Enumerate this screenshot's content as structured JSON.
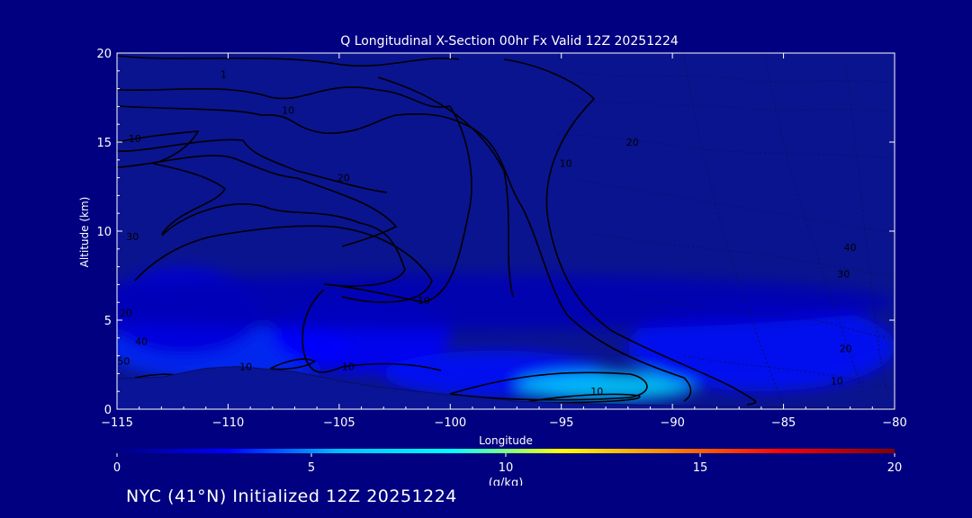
{
  "footer_text": "NYC (41°N) Initialized 12Z 20251224",
  "chart_data": {
    "type": "heatmap",
    "title": "Q Longitudinal X-Section 00hr  Fx Valid 12Z 20251224",
    "xlabel": "Longitude",
    "ylabel": "Altitude (km)",
    "xlim": [
      -115,
      -80
    ],
    "ylim": [
      0,
      20
    ],
    "xticks": [
      -115,
      -110,
      -105,
      -100,
      -95,
      -90,
      -85,
      -80
    ],
    "xtick_labels": [
      "−115",
      "−110",
      "−105",
      "−100",
      "−95",
      "−90",
      "−85",
      "−80"
    ],
    "yticks": [
      0,
      5,
      10,
      15,
      20
    ],
    "colorbar": {
      "label": "(g/kg)",
      "range": [
        0,
        20
      ],
      "ticks": [
        0,
        5,
        10,
        15,
        20
      ],
      "colors": [
        "#000080",
        "#0000ff",
        "#00bfff",
        "#00ffff",
        "#ffff00",
        "#ff8000",
        "#ff0000",
        "#800000"
      ]
    },
    "terrain": [
      {
        "x": -115,
        "y": 1.7
      },
      {
        "x": -113,
        "y": 1.8
      },
      {
        "x": -111,
        "y": 2.3
      },
      {
        "x": -109.5,
        "y": 2.4
      },
      {
        "x": -107,
        "y": 2.1
      },
      {
        "x": -105,
        "y": 1.6
      },
      {
        "x": -103,
        "y": 1.2
      },
      {
        "x": -100,
        "y": 0.8
      },
      {
        "x": -97,
        "y": 0.45
      },
      {
        "x": -95,
        "y": 0.35
      },
      {
        "x": -90,
        "y": 0.2
      },
      {
        "x": -85,
        "y": 0.1
      },
      {
        "x": -80,
        "y": 0.05
      }
    ],
    "moisture_regions": [
      {
        "xc": -110,
        "yc": 3.4,
        "rx": 5.5,
        "ry": 1.8,
        "q": 3.5
      },
      {
        "xc": -104,
        "yc": 4.2,
        "rx": 4.0,
        "ry": 2.2,
        "q": 2.8
      },
      {
        "xc": -98,
        "yc": 2.0,
        "rx": 5.0,
        "ry": 1.3,
        "q": 3.0
      },
      {
        "xc": -93,
        "yc": 1.3,
        "rx": 4.0,
        "ry": 0.8,
        "q": 6.5
      },
      {
        "xc": -86,
        "yc": 3.5,
        "rx": 6.0,
        "ry": 2.5,
        "q": 3.0
      },
      {
        "xc": -112,
        "yc": 5.5,
        "rx": 3.5,
        "ry": 2.5,
        "q": 2.0
      },
      {
        "xc": -100,
        "yc": 6.0,
        "rx": 20.0,
        "ry": 1.6,
        "q": 1.2
      }
    ],
    "contour_labels": [
      {
        "x": -110.2,
        "y": 18.6,
        "text": "1"
      },
      {
        "x": -107.3,
        "y": 16.6,
        "text": "10"
      },
      {
        "x": -114.2,
        "y": 15.0,
        "text": "10"
      },
      {
        "x": -104.8,
        "y": 12.8,
        "text": "20"
      },
      {
        "x": -114.3,
        "y": 9.5,
        "text": "30"
      },
      {
        "x": -101.2,
        "y": 5.9,
        "text": "10"
      },
      {
        "x": -114.6,
        "y": 5.2,
        "text": "20"
      },
      {
        "x": -113.9,
        "y": 3.6,
        "text": "40"
      },
      {
        "x": -114.7,
        "y": 2.5,
        "text": "50"
      },
      {
        "x": -109.2,
        "y": 2.2,
        "text": "10"
      },
      {
        "x": -104.6,
        "y": 2.2,
        "text": "10"
      },
      {
        "x": -93.4,
        "y": 0.8,
        "text": "10"
      },
      {
        "x": -94.8,
        "y": 13.6,
        "text": "10"
      },
      {
        "x": -91.8,
        "y": 14.8,
        "text": "20"
      },
      {
        "x": -82.0,
        "y": 8.9,
        "text": "40"
      },
      {
        "x": -82.3,
        "y": 7.4,
        "text": "30"
      },
      {
        "x": -82.2,
        "y": 3.2,
        "text": "20"
      },
      {
        "x": -82.6,
        "y": 1.4,
        "text": "10"
      }
    ]
  }
}
